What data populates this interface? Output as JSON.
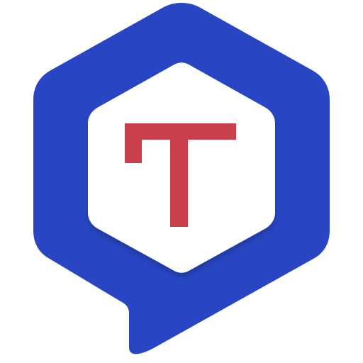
{
  "app_icon": {
    "icon_name": "hexagon-speech-bubble-t-logo-icon",
    "colors": {
      "background": "#ffffff",
      "bubble": "#2846C3",
      "inner": "#ffffff",
      "letter": "#CB3F4B"
    }
  }
}
